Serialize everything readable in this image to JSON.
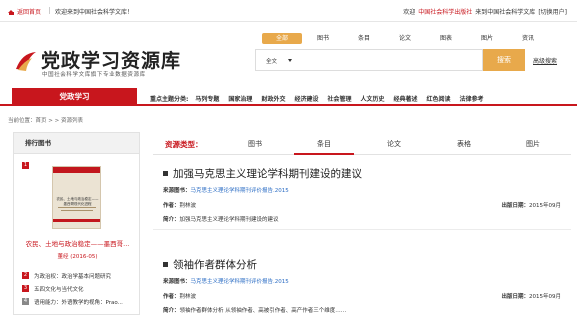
{
  "topbar": {
    "home": "返回首页",
    "welcome": "欢迎来到中国社会科学文库！",
    "right_pre": "欢迎",
    "right_org": "中国社会科学出版社",
    "right_post": "来到中国社会科学文库",
    "switch": "[切换用户]"
  },
  "logo": {
    "title": "党政学习资源库",
    "subtitle": "中国社会科学文库旗下专业数据资源库"
  },
  "navtabs": [
    "全部",
    "图书",
    "条目",
    "论文",
    "图表",
    "图片",
    "资讯"
  ],
  "search": {
    "scope": "全文",
    "placeholder": "",
    "button": "搜索",
    "advanced": "高级搜索"
  },
  "mainnav": {
    "tab": "党政学习",
    "label": "重点主题分类:",
    "topics": [
      "马列专题",
      "国家治理",
      "财政外交",
      "经济建设",
      "社会管理",
      "人文历史",
      "经典著述",
      "红色阅读",
      "法律参考"
    ]
  },
  "breadcrumb": "当前位置：首页 > > 资源列表",
  "sidebar": {
    "heading": "排行图书",
    "first": {
      "num": "1",
      "cover_title": "农民、土地与政治稳定——墨西哥现代化进程",
      "title": "农民、土地与政治稳定——墨西哥...",
      "date": "董经 (2016-05)"
    },
    "items": [
      {
        "num": "2",
        "text": "为政治权：政治学基本问题研究"
      },
      {
        "num": "3",
        "text": "五四文化与当代文化"
      },
      {
        "num": "4",
        "text": "语用能力：外语教学的视角：Prao..."
      }
    ]
  },
  "content": {
    "tabs_label": "资源类型：",
    "tabs": [
      "图书",
      "条目",
      "论文",
      "表格",
      "图片"
    ],
    "results": [
      {
        "title": "加强马克思主义理论学科期刊建设的建议",
        "source_label": "来源图书：",
        "source": "马克思主义理论学科期刊评价报告.2015",
        "author_label": "作者：",
        "author": "荆林波",
        "date_label": "出版日期：",
        "date": "2015年09月",
        "abstract_label": "简介：",
        "abstract": "加强马克思主义理论学科期刊建设的建议"
      },
      {
        "title": "领袖作者群体分析",
        "source_label": "来源图书：",
        "source": "马克思主义理论学科期刊评价报告.2015",
        "author_label": "作者：",
        "author": "荆林波",
        "date_label": "出版日期：",
        "date": "2015年09月",
        "abstract_label": "简介：",
        "abstract": "领袖作者群体分析 从领袖作者、高被引作者、高产作者三个维度……"
      }
    ]
  },
  "colors": {
    "brand_red": "#c8161d",
    "accent_orange": "#e8a94b",
    "link_blue": "#2a6cc4"
  }
}
